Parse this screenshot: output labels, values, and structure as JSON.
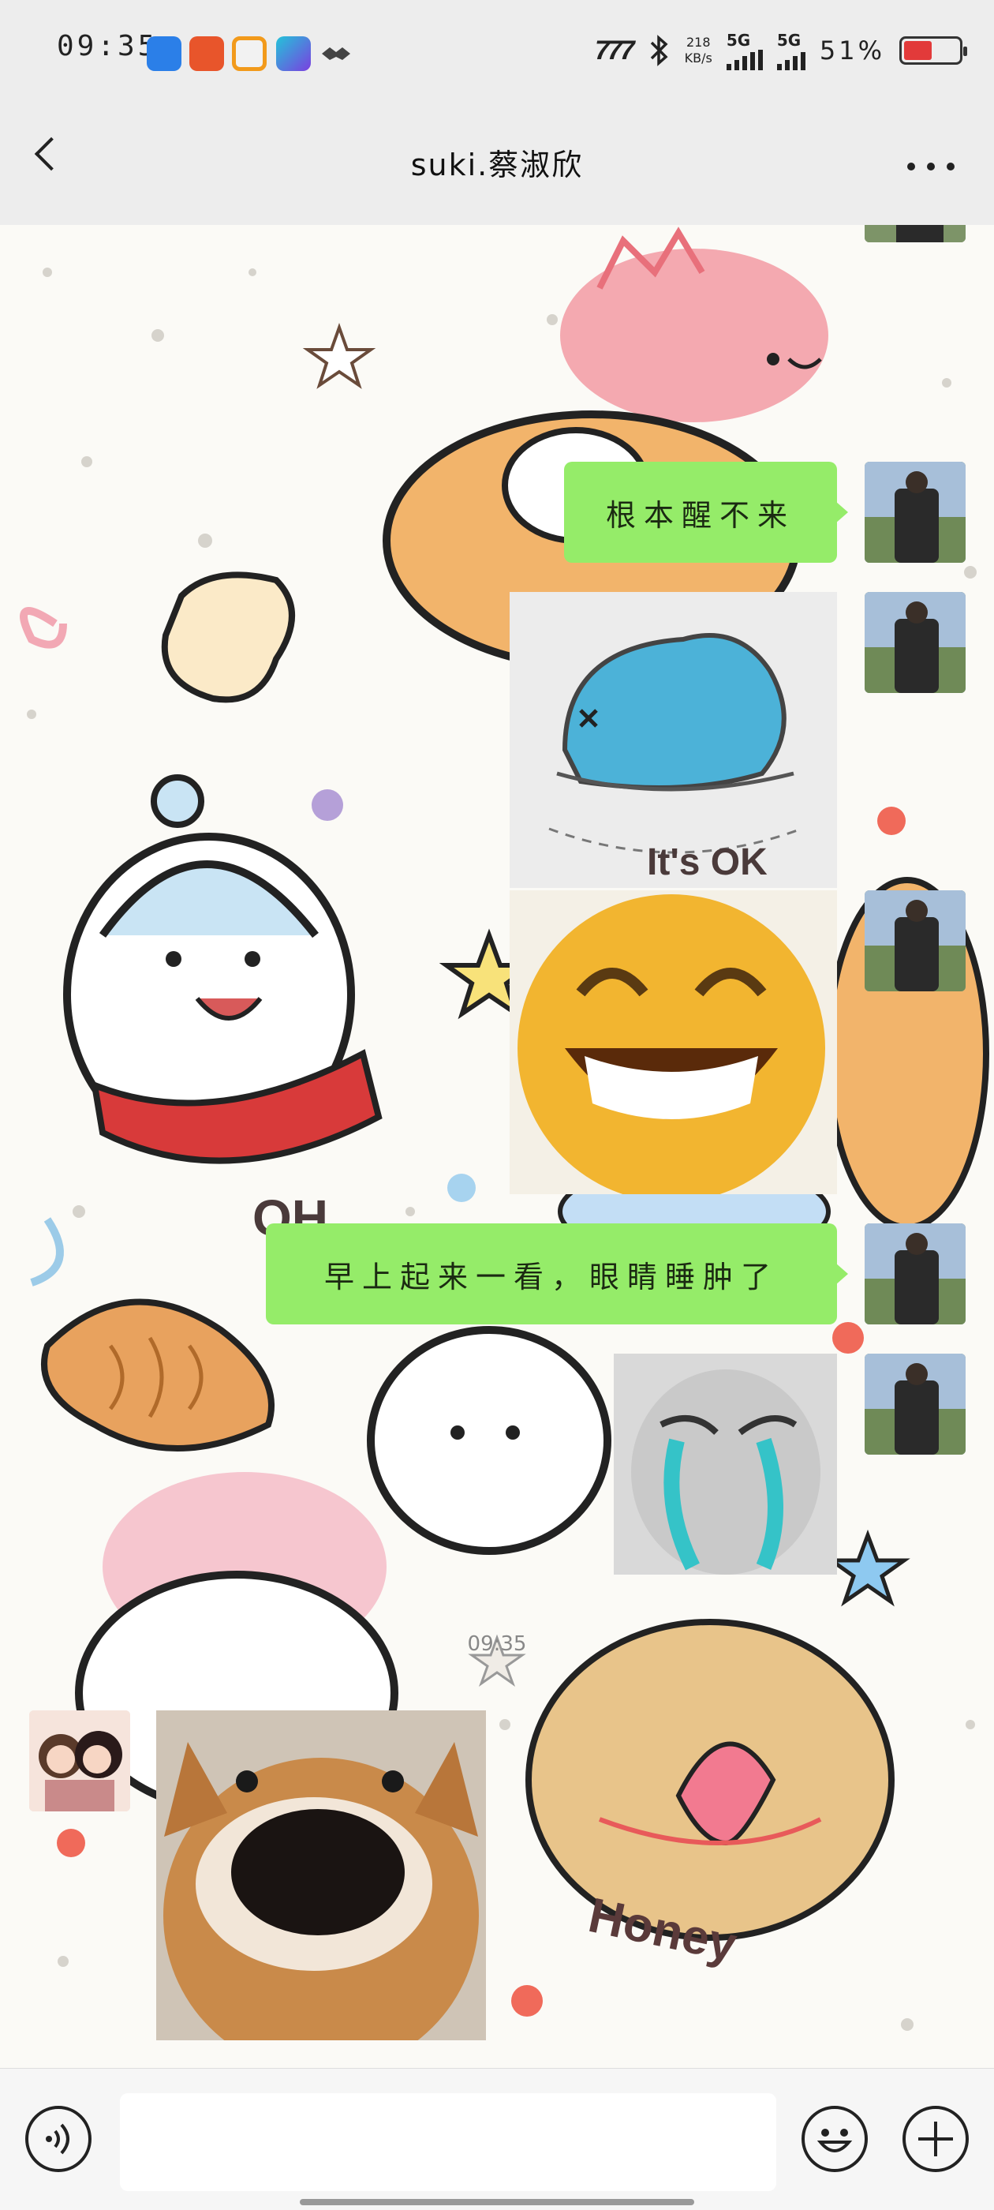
{
  "status_bar": {
    "time": "09:35",
    "net_speed_value": "218",
    "net_speed_unit": "KB/s",
    "signal_1": "5G",
    "signal_2": "5G",
    "battery_percent": "51%",
    "battery_level": 0.51,
    "battery_color": "#e23a3a",
    "app_icons": [
      "assistant-app-icon",
      "shopping-app-icon",
      "video-app-icon",
      "canva-app-icon",
      "handshake-app-icon"
    ],
    "bluetooth_icon": "bluetooth-icon",
    "carrier_logo_text": "777"
  },
  "header": {
    "title": "suki.蔡淑欣",
    "back_icon": "chevron-left-icon",
    "more_icon": "more-icon"
  },
  "messages": {
    "msg1_text": "根本醒不来",
    "msg5_text": "早上起来一看，眼睛睡肿了",
    "timestamp": "09:35"
  },
  "stickers": {
    "blue_creature_caption": "It's OK",
    "wallpaper_text_1": "Honey",
    "wallpaper_text_2": "OH"
  },
  "input_bar": {
    "placeholder": "",
    "voice_icon": "voice-icon",
    "emoji_icon": "emoji-icon",
    "add_icon": "plus-icon"
  },
  "colors": {
    "bubble_green": "#95ec69",
    "bar_bg": "#ededed",
    "chat_bg": "#fbfaf6"
  }
}
